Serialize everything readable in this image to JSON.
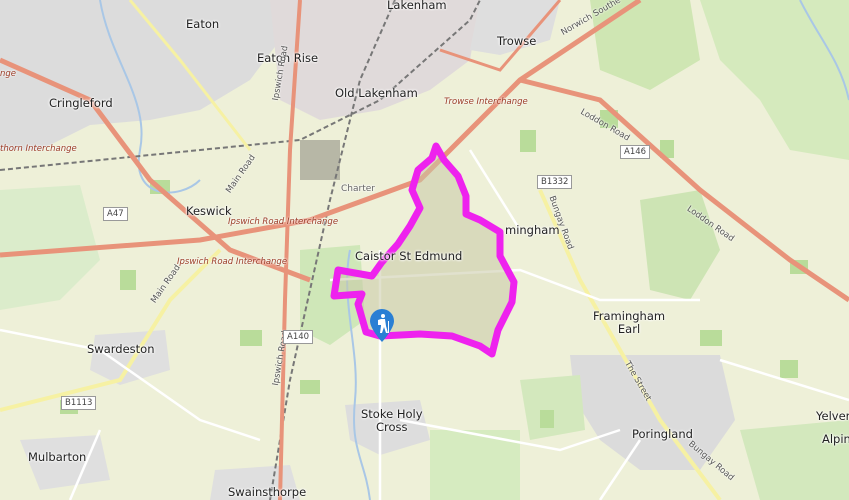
{
  "places": {
    "eaton": "Eaton",
    "lakenham": "Lakenham",
    "eaton_rise": "Eaton Rise",
    "trowse": "Trowse",
    "cringleford": "Cringleford",
    "old_lakenham": "Old Lakenham",
    "keswick": "Keswick",
    "caistor_st_edmund": "Caistor St Edmund",
    "framingham_earl": "Framingham\nEarl",
    "swardeston": "Swardeston",
    "stoke_holy_cross": "Stoke Holy\nCross",
    "poringland": "Poringland",
    "mulbarton": "Mulbarton",
    "swainsthorpe": "Swainsthorpe",
    "bixley_partial": "mingham",
    "yelverton_partial": "Yelvert",
    "alpington_partial": "Alpin",
    "chartan_partial": "Charter"
  },
  "roads": {
    "trowse_interchange": "Trowse Interchange",
    "ipswich_road_interchange": "Ipswich Road Interchange",
    "ipswich_road_interchange_2": "Ipswich Road Interchange",
    "thickthorn_interchange": "thorn Interchange",
    "ipswich_road": "Ipswich Road",
    "main_road": "Main Road",
    "main_road_2": "Main Road",
    "loddon_road": "Loddon Road",
    "loddon_road_2": "Loddon Road",
    "norwich_southern": "Norwich Southe",
    "bungay_road": "Bungay Road",
    "bungay_road_2": "Bungay Road",
    "the_street": "The Street",
    "partial_left": "nge"
  },
  "road_refs": {
    "a47": "A47",
    "a146": "A146",
    "a140": "A140",
    "b1332": "B1332",
    "b1113": "B1113"
  },
  "overlay": {
    "boundary_color": "#ee22ee",
    "marker_color": "#2a7fd4",
    "marker_icon": "hiker-icon"
  }
}
